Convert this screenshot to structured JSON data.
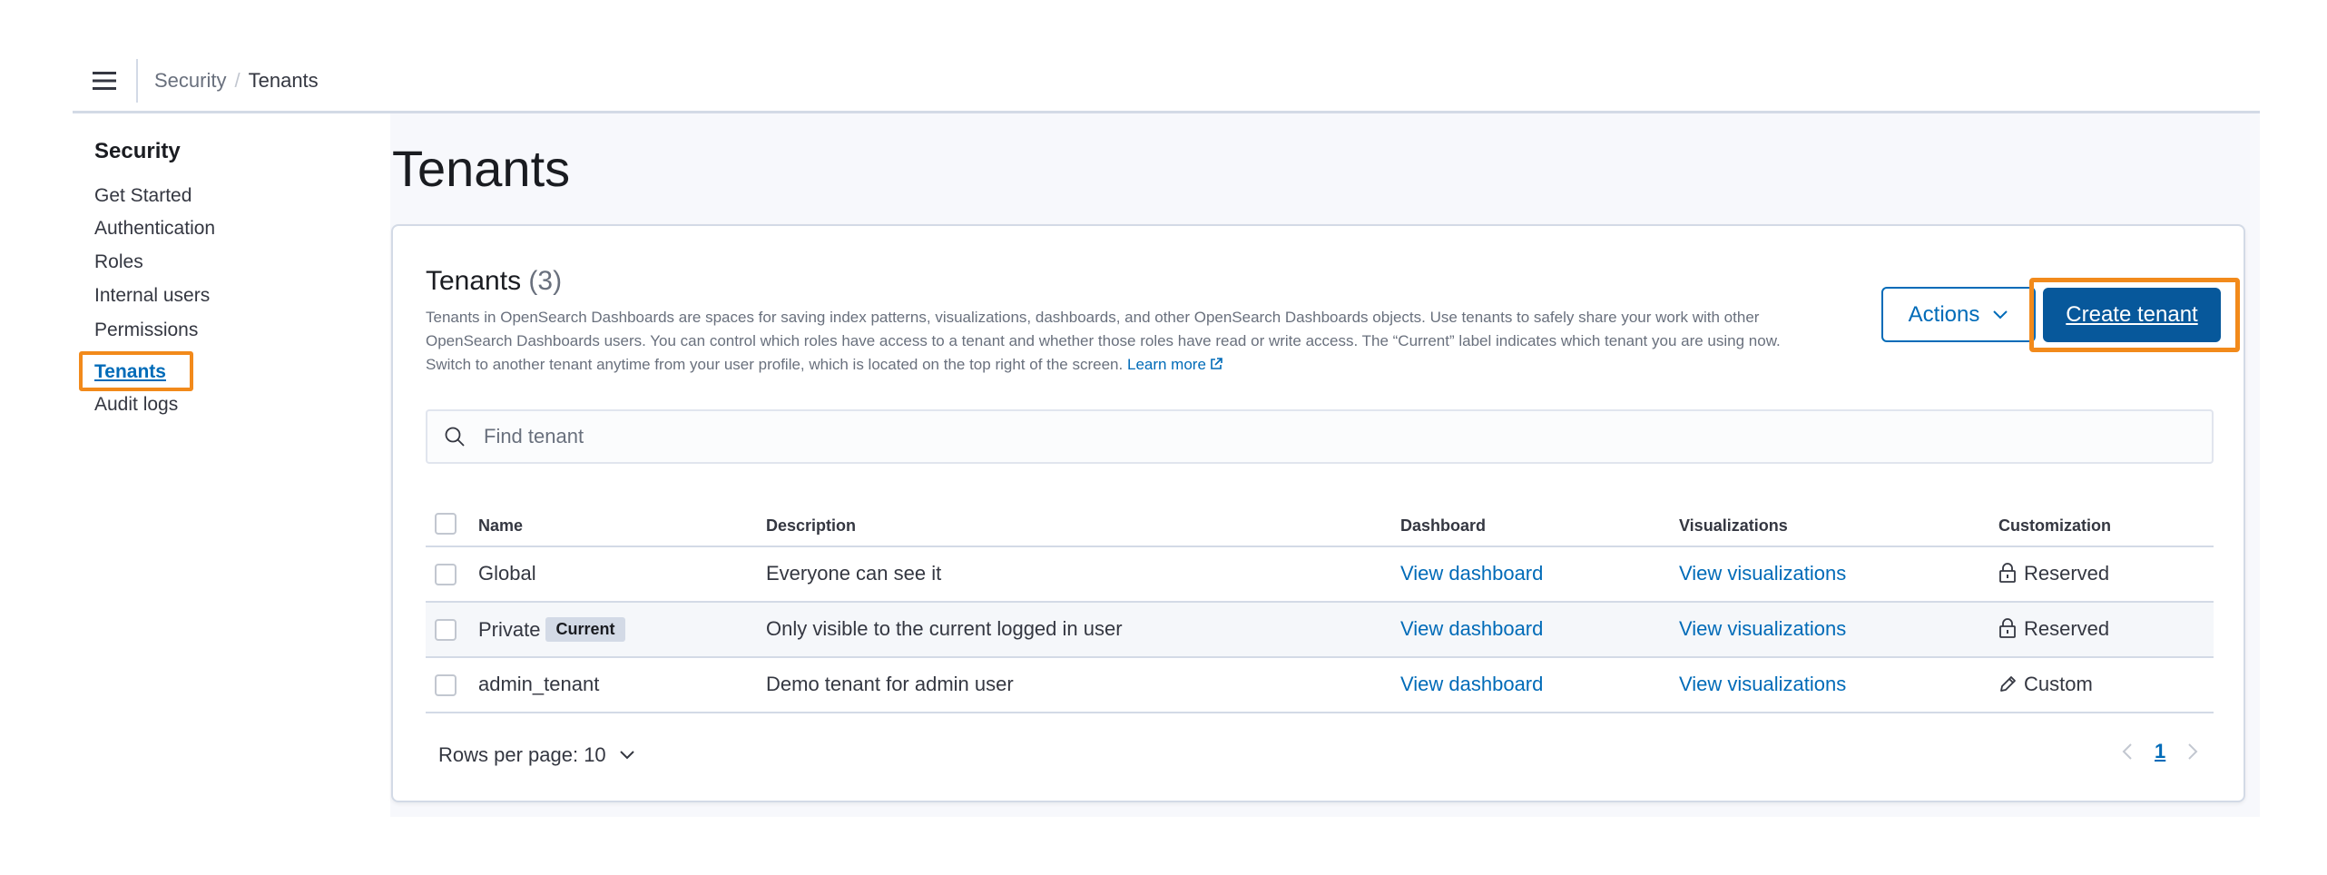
{
  "header": {
    "breadcrumbs": [
      "Security",
      "Tenants"
    ],
    "menu_icon": "hamburger-icon"
  },
  "sidebar": {
    "title": "Security",
    "items": [
      {
        "label": "Get Started"
      },
      {
        "label": "Authentication"
      },
      {
        "label": "Roles"
      },
      {
        "label": "Internal users"
      },
      {
        "label": "Permissions"
      },
      {
        "label": "Tenants",
        "active": true
      },
      {
        "label": "Audit logs"
      }
    ]
  },
  "main": {
    "page_title": "Tenants",
    "panel": {
      "title": "Tenants",
      "count": "(3)",
      "description": "Tenants in OpenSearch Dashboards are spaces for saving index patterns, visualizations, dashboards, and other OpenSearch Dashboards objects. Use tenants to safely share your work with other OpenSearch Dashboards users. You can control which roles have access to a tenant and whether those roles have read or write access. The “Current” label indicates which tenant you are using now. Switch to another tenant anytime from your user profile, which is located on the top right of the screen.",
      "learn_more": "Learn more",
      "actions_label": "Actions",
      "create_label": "Create tenant"
    },
    "search": {
      "placeholder": "Find tenant",
      "value": ""
    },
    "table": {
      "columns": [
        "Name",
        "Description",
        "Dashboard",
        "Visualizations",
        "Customization"
      ],
      "rows": [
        {
          "name": "Global",
          "badge": "",
          "description": "Everyone can see it",
          "dashboard": "View dashboard",
          "visualizations": "View visualizations",
          "customization": "Reserved",
          "icon": "lock-icon"
        },
        {
          "name": "Private",
          "badge": "Current",
          "description": "Only visible to the current logged in user",
          "dashboard": "View dashboard",
          "visualizations": "View visualizations",
          "customization": "Reserved",
          "icon": "lock-icon"
        },
        {
          "name": "admin_tenant",
          "badge": "",
          "description": "Demo tenant for admin user",
          "dashboard": "View dashboard",
          "visualizations": "View visualizations",
          "customization": "Custom",
          "icon": "pencil-icon"
        }
      ]
    },
    "pagination": {
      "rows_per_page": "Rows per page: 10",
      "current_page": "1"
    }
  },
  "colors": {
    "accent": "#006bb8",
    "primary_button": "#07589b",
    "highlight": "#f28a1b"
  }
}
